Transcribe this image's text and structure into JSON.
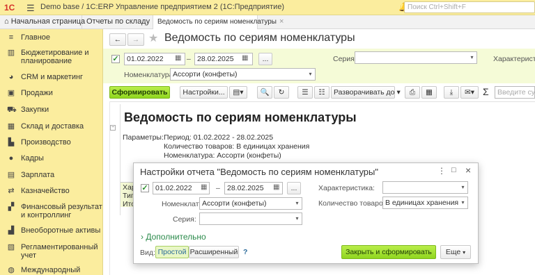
{
  "titlebar": {
    "logo": "1C",
    "title": "Demo base / 1С:ERP Управление предприятием 2  (1С:Предприятие)",
    "search_placeholder": "Поиск Ctrl+Shift+F"
  },
  "tabs": [
    {
      "label": "Начальная страница"
    },
    {
      "label": "Отчеты по складу"
    },
    {
      "label": "Ведомость по сериям номенклатуры"
    }
  ],
  "sidebar": {
    "items": [
      {
        "label": "Главное",
        "icon": "menu-icon"
      },
      {
        "label": "Бюджетирование и планирование",
        "icon": "chart-icon"
      },
      {
        "label": "CRM и маркетинг",
        "icon": "pie-icon"
      },
      {
        "label": "Продажи",
        "icon": "bag-icon"
      },
      {
        "label": "Закупки",
        "icon": "cart-icon"
      },
      {
        "label": "Склад и доставка",
        "icon": "warehouse-icon"
      },
      {
        "label": "Производство",
        "icon": "factory-icon"
      },
      {
        "label": "Кадры",
        "icon": "people-icon"
      },
      {
        "label": "Зарплата",
        "icon": "money-icon"
      },
      {
        "label": "Казначейство",
        "icon": "treasury-icon"
      },
      {
        "label": "Финансовый результат и контроллинг",
        "icon": "finance-icon"
      },
      {
        "label": "Внеоборотные активы",
        "icon": "assets-icon"
      },
      {
        "label": "Регламентированный учет",
        "icon": "book-icon"
      },
      {
        "label": "Международный",
        "icon": "globe-icon"
      }
    ]
  },
  "report": {
    "title": "Ведомость по сериям номенклатуры",
    "date_from": "01.02.2022",
    "date_to": "28.02.2025",
    "dash": "–",
    "ellipsis": "...",
    "series_label": "Серия:",
    "char_label": "Характеристи",
    "nomenclature_label": "Номенклатура:",
    "nomenclature_value": "Ассорти (конфеты)",
    "generate_button": "Сформировать",
    "settings_button": "Настройки...",
    "expand_button": "Разворачивать до",
    "sum_symbol": "Σ",
    "sum_placeholder": "Введите сумм"
  },
  "document": {
    "heading": "Ведомость по сериям номенклатуры",
    "params_label": "Параметры:",
    "params": [
      "Период: 01.02.2022 - 28.02.2025",
      "Количество товаров: В единицах хранения",
      "Номенклатура: Ассорти (конфеты)"
    ],
    "row_labels": [
      "Хар",
      "Тип",
      "Ито"
    ]
  },
  "dialog": {
    "title": "Настройки отчета \"Ведомость по сериям номенклатуры\"",
    "date_from": "01.02.2022",
    "date_to": "28.02.2025",
    "dash": "–",
    "ellipsis": "...",
    "nomenclature_label": "Номенклатура:",
    "nomenclature_value": "Ассорти (конфеты)",
    "series_label": "Серия:",
    "char_label": "Характеристика:",
    "qty_label": "Количество товаров:",
    "qty_value": "В единицах хранения",
    "more_label": "Дополнительно",
    "view_label": "Вид:",
    "view_simple": "Простой",
    "view_extended": "Расширенный",
    "help": "?",
    "close_generate_button": "Закрыть и сформировать",
    "more_button": "Еще"
  }
}
